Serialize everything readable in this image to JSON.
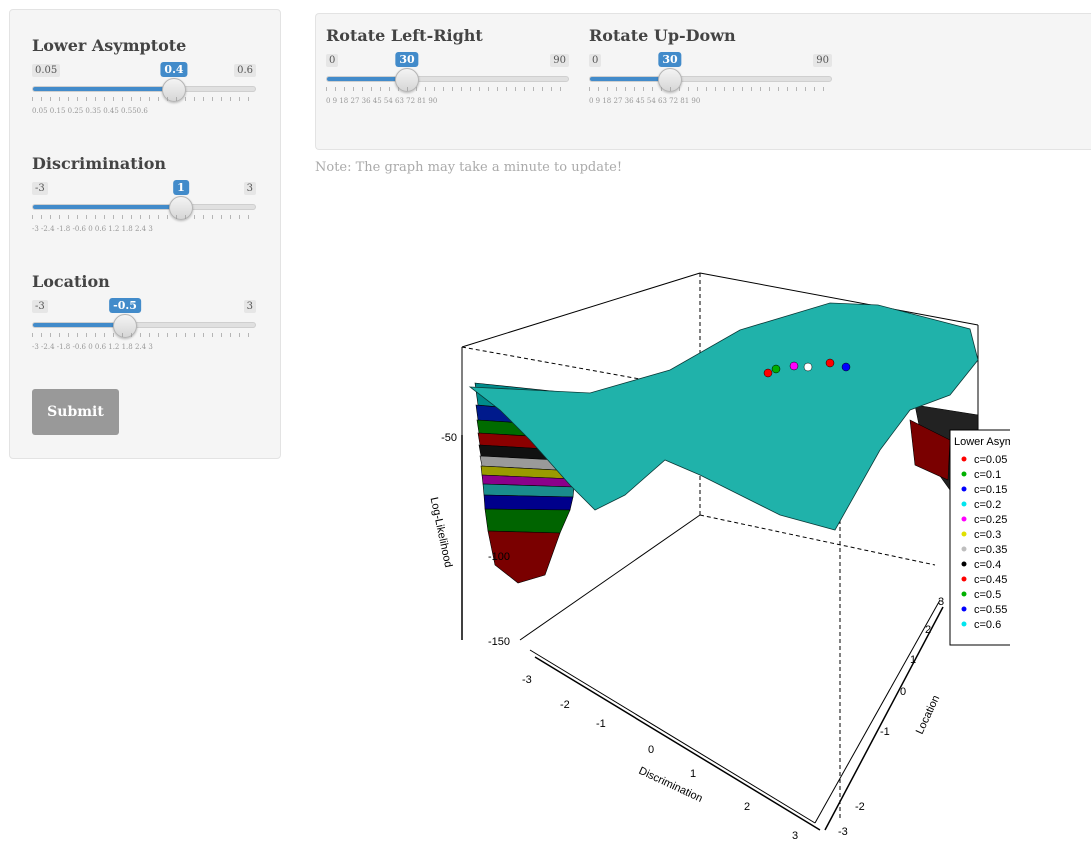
{
  "sidebar": {
    "sliders": [
      {
        "label": "Lower Asymptote",
        "min": "0.05",
        "max": "0.6",
        "value": "0.4",
        "fraction": 0.636,
        "ticks": "0.05   0.15   0.25   0.35   0.45   0.550.6"
      },
      {
        "label": "Discrimination",
        "min": "-3",
        "max": "3",
        "value": "1",
        "fraction": 0.667,
        "ticks": "-3 -2.4 -1.8     -0.6  0   0.6 1.2 1.8 2.4  3"
      },
      {
        "label": "Location",
        "min": "-3",
        "max": "3",
        "value": "-0.5",
        "fraction": 0.417,
        "ticks": "-3 -2.4 -1.8     -0.6  0   0.6 1.2 1.8 2.4  3"
      }
    ],
    "submit_label": "Submit"
  },
  "top_controls": {
    "sliders": [
      {
        "label": "Rotate Left-Right",
        "min": "0",
        "max": "90",
        "value": "30",
        "fraction": 0.333,
        "ticks": "0   9  18  27  36  45  54  63  72  81  90"
      },
      {
        "label": "Rotate Up-Down",
        "min": "0",
        "max": "90",
        "value": "30",
        "fraction": 0.333,
        "ticks": "0   9  18  27  36  45  54  63  72  81  90"
      }
    ]
  },
  "note": "Note: The graph may take a minute to update!",
  "chart_data": {
    "type": "surface",
    "title": "",
    "xlabel": "Discrimination",
    "ylabel": "Location",
    "zlabel": "Log-Likelihood",
    "x_ticks": [
      "-3",
      "-2",
      "-1",
      "0",
      "1",
      "2",
      "3"
    ],
    "y_ticks": [
      "-3",
      "-2",
      "-1",
      "0",
      "1",
      "2",
      "3"
    ],
    "z_ticks": [
      "-50",
      "-100",
      "-150"
    ],
    "xlim": [
      -3,
      3
    ],
    "ylim": [
      -3,
      3
    ],
    "zlim": [
      -150,
      -40
    ],
    "legend": {
      "title": "Lower Asymptote",
      "placement": "right",
      "entries": [
        {
          "label": "c=0.05",
          "color": "#ff0000"
        },
        {
          "label": "c=0.1",
          "color": "#00b000"
        },
        {
          "label": "c=0.15",
          "color": "#0000ff"
        },
        {
          "label": "c=0.2",
          "color": "#00e5ee"
        },
        {
          "label": "c=0.25",
          "color": "#ff00ff"
        },
        {
          "label": "c=0.3",
          "color": "#e0e000"
        },
        {
          "label": "c=0.35",
          "color": "#bebebe"
        },
        {
          "label": "c=0.4",
          "color": "#000000"
        },
        {
          "label": "c=0.45",
          "color": "#ff0000"
        },
        {
          "label": "c=0.5",
          "color": "#00b000"
        },
        {
          "label": "c=0.55",
          "color": "#0000ff"
        },
        {
          "label": "c=0.6",
          "color": "#00e5ee"
        }
      ]
    }
  }
}
